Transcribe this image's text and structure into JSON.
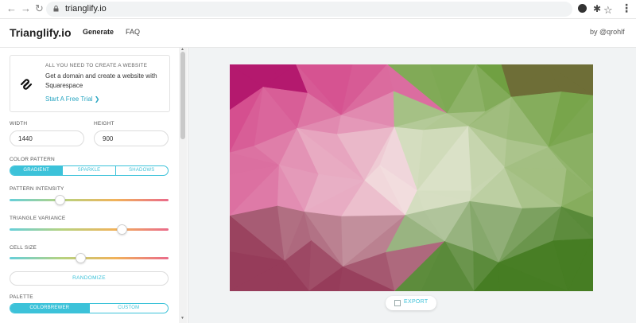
{
  "browser": {
    "url": "trianglify.io"
  },
  "header": {
    "logo": "Trianglify.io",
    "nav": {
      "generate": "Generate",
      "faq": "FAQ"
    },
    "byline": "by @qrohlf"
  },
  "ad": {
    "kicker": "ALL YOU NEED TO CREATE A WEBSITE",
    "body": "Get a domain and create a website with Squarespace",
    "cta": "Start A Free Trial ❯"
  },
  "controls": {
    "width_label": "WIDTH",
    "width_value": "1440",
    "height_label": "HEIGHT",
    "height_value": "900",
    "color_pattern_label": "COLOR PATTERN",
    "color_pattern_options": [
      "GRADIENT",
      "SPARKLE",
      "SHADOWS"
    ],
    "color_pattern_selected": "GRADIENT",
    "pattern_intensity_label": "PATTERN INTENSITY",
    "pattern_intensity_value": 0.31,
    "triangle_variance_label": "TRIANGLE VARIANCE",
    "triangle_variance_value": 0.7,
    "cell_size_label": "CELL SIZE",
    "cell_size_value": 0.44,
    "randomize_label": "RANDOMIZE",
    "palette_label": "PALETTE",
    "palette_options": [
      "COLORBREWER",
      "CUSTOM"
    ],
    "palette_selected": "COLORBREWER"
  },
  "preview": {
    "export_label": "EXPORT"
  },
  "colors": {
    "accent": "#3cc2d9",
    "gradient_top_left": "#b4196e",
    "gradient_center": "#f4f1ea",
    "gradient_right": "#6a9a3a",
    "gradient_bottom_right": "#3c7d20"
  }
}
